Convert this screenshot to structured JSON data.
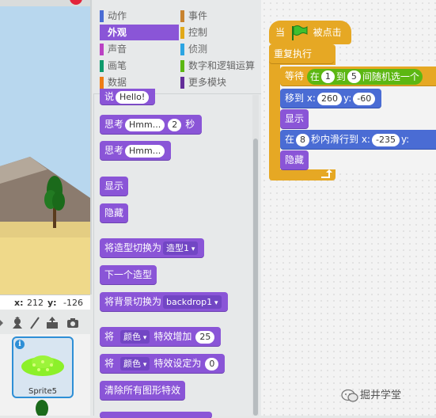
{
  "stage": {
    "x_label": "x:",
    "x_value": "212",
    "y_label": "y:",
    "y_value": "-126"
  },
  "sprite": {
    "name": "Sprite5",
    "info": "i"
  },
  "categories": [
    {
      "label": "动作",
      "color": "#4a6cd4"
    },
    {
      "label": "事件",
      "color": "#c88330"
    },
    {
      "label": "外观",
      "color": "#8a55d7"
    },
    {
      "label": "控制",
      "color": "#e1a91a"
    },
    {
      "label": "声音",
      "color": "#bb42c3"
    },
    {
      "label": "侦测",
      "color": "#2ca5e2"
    },
    {
      "label": "画笔",
      "color": "#0e9a6c"
    },
    {
      "label": "数字和逻辑运算",
      "color": "#5cb712"
    },
    {
      "label": "数据",
      "color": "#ee7d16"
    },
    {
      "label": "更多模块",
      "color": "#632d99"
    }
  ],
  "palette": {
    "say_label": "说",
    "say_value": "Hello!",
    "think_secs_label": "思考",
    "think_secs_value": "Hmm...",
    "think_secs_num": "2",
    "think_secs_unit": "秒",
    "think_label": "思考",
    "think_value": "Hmm...",
    "show": "显示",
    "hide": "隐藏",
    "switch_costume_label": "将造型切换为",
    "switch_costume_value": "造型1",
    "next_costume": "下一个造型",
    "switch_backdrop_label": "将背景切换为",
    "switch_backdrop_value": "backdrop1",
    "change_effect_prefix": "将",
    "change_effect_dropdown": "颜色",
    "change_effect_mid": "特效增加",
    "change_effect_value": "25",
    "set_effect_prefix": "将",
    "set_effect_dropdown": "颜色",
    "set_effect_mid": "特效设定为",
    "set_effect_value": "0",
    "clear_effects": "清除所有图形特效"
  },
  "script": {
    "hat_prefix": "当",
    "hat_suffix": "被点击",
    "forever": "重复执行",
    "wait_label": "等待",
    "random_prefix": "在",
    "random_from": "1",
    "random_to_label": "到",
    "random_to": "5",
    "random_suffix": "间随机选一个",
    "goto_label": "移到 x:",
    "goto_x": "260",
    "goto_y_label": "y:",
    "goto_y": "-60",
    "show": "显示",
    "glide_prefix": "在",
    "glide_secs": "8",
    "glide_mid": "秒内滑行到 x:",
    "glide_x": "-235",
    "glide_y_label": "y:",
    "hide": "隐藏"
  },
  "watermark": "掘井学堂"
}
